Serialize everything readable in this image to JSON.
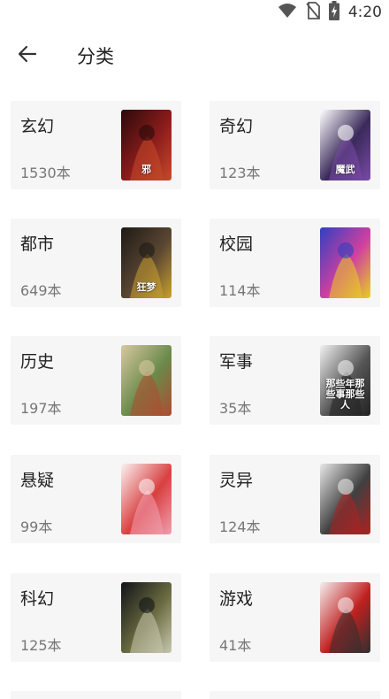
{
  "status_bar": {
    "time": "4:20"
  },
  "header": {
    "title": "分类"
  },
  "categories": [
    {
      "name": "玄幻",
      "count": "1530本",
      "cover_text": "邪",
      "cover_colors": [
        "#2a0a0a",
        "#8c1c1c",
        "#c64a2a"
      ]
    },
    {
      "name": "奇幻",
      "count": "123本",
      "cover_text": "魔武",
      "cover_colors": [
        "#ffffff",
        "#3a2a5a",
        "#7a4aa8"
      ]
    },
    {
      "name": "都市",
      "count": "649本",
      "cover_text": "狂梦",
      "cover_colors": [
        "#1e1a16",
        "#5a4632",
        "#c8a030"
      ]
    },
    {
      "name": "校园",
      "count": "114本",
      "cover_text": "",
      "cover_colors": [
        "#3040c0",
        "#d040a0",
        "#e8d020"
      ]
    },
    {
      "name": "历史",
      "count": "197本",
      "cover_text": "",
      "cover_colors": [
        "#d8c8a0",
        "#6a8a4a",
        "#b04a30"
      ]
    },
    {
      "name": "军事",
      "count": "35本",
      "cover_text": "那些年那些事那些人",
      "cover_colors": [
        "#f2f2f2",
        "#555555",
        "#222222"
      ]
    },
    {
      "name": "悬疑",
      "count": "99本",
      "cover_text": "",
      "cover_colors": [
        "#fbf2f2",
        "#d84040",
        "#f0a0b0"
      ]
    },
    {
      "name": "灵异",
      "count": "124本",
      "cover_text": "",
      "cover_colors": [
        "#e8e8e8",
        "#404040",
        "#b02020"
      ]
    },
    {
      "name": "科幻",
      "count": "125本",
      "cover_text": "",
      "cover_colors": [
        "#101418",
        "#6a6a40",
        "#c8c8b0"
      ]
    },
    {
      "name": "游戏",
      "count": "41本",
      "cover_text": "",
      "cover_colors": [
        "#f4eeee",
        "#c02020",
        "#303030"
      ]
    }
  ]
}
